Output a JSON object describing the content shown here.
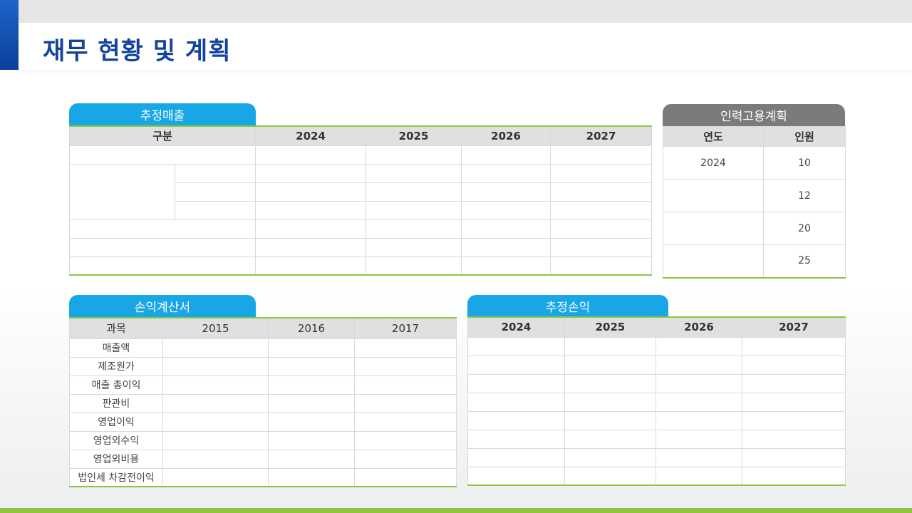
{
  "page": {
    "title": "재무 현황 및 계획"
  },
  "colors": {
    "accent_blue": "#19a6e6",
    "title_blue": "#12439e",
    "green_line": "#8cc63f",
    "gray_tab": "#7b7b7b"
  },
  "sales": {
    "tab": "추정매출",
    "header": {
      "category": "구분",
      "years": [
        "2024",
        "2025",
        "2026",
        "2027"
      ]
    }
  },
  "hiring": {
    "tab": "인력고용계획",
    "header": {
      "year": "연도",
      "people": "인원"
    },
    "rows": [
      {
        "year": "2024",
        "people": "10"
      },
      {
        "year": "",
        "people": "12"
      },
      {
        "year": "",
        "people": "20"
      },
      {
        "year": "",
        "people": "25"
      }
    ]
  },
  "income": {
    "tab": "손익계산서",
    "header": {
      "item": "과목",
      "years": [
        "2015",
        "2016",
        "2017"
      ]
    },
    "items": [
      "매출액",
      "제조원가",
      "매출 총이익",
      "판관비",
      "영업이익",
      "영업외수익",
      "영업외비용",
      "법인세 차감전이익"
    ]
  },
  "estimate": {
    "tab": "추정손익",
    "header": {
      "years": [
        "2024",
        "2025",
        "2026",
        "2027"
      ]
    }
  }
}
